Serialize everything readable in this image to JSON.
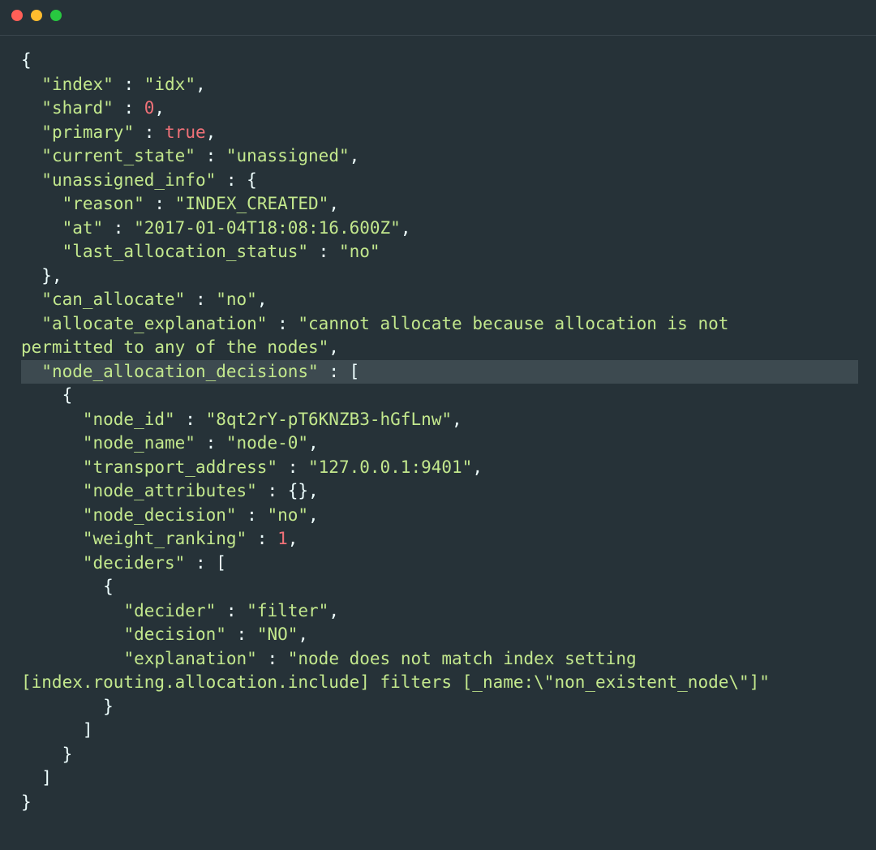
{
  "window": {
    "controls": [
      {
        "name": "close-button",
        "color": "#ff5f57"
      },
      {
        "name": "minimize-button",
        "color": "#febc2e"
      },
      {
        "name": "zoom-button",
        "color": "#28c840"
      }
    ]
  },
  "colors": {
    "background": "#263238",
    "string": "#c3e88d",
    "number": "#f07178",
    "punctuation": "#eeffff",
    "highlight": "#3d4a50"
  },
  "code": {
    "highlighted_line": 13,
    "lines": [
      [
        {
          "t": "p",
          "v": "{"
        }
      ],
      [
        {
          "t": "p",
          "v": "  "
        },
        {
          "t": "k",
          "v": "\"index\""
        },
        {
          "t": "p",
          "v": " : "
        },
        {
          "t": "s",
          "v": "\"idx\""
        },
        {
          "t": "p",
          "v": ","
        }
      ],
      [
        {
          "t": "p",
          "v": "  "
        },
        {
          "t": "k",
          "v": "\"shard\""
        },
        {
          "t": "p",
          "v": " : "
        },
        {
          "t": "n",
          "v": "0"
        },
        {
          "t": "p",
          "v": ","
        }
      ],
      [
        {
          "t": "p",
          "v": "  "
        },
        {
          "t": "k",
          "v": "\"primary\""
        },
        {
          "t": "p",
          "v": " : "
        },
        {
          "t": "b",
          "v": "true"
        },
        {
          "t": "p",
          "v": ","
        }
      ],
      [
        {
          "t": "p",
          "v": "  "
        },
        {
          "t": "k",
          "v": "\"current_state\""
        },
        {
          "t": "p",
          "v": " : "
        },
        {
          "t": "s",
          "v": "\"unassigned\""
        },
        {
          "t": "p",
          "v": ","
        }
      ],
      [
        {
          "t": "p",
          "v": "  "
        },
        {
          "t": "k",
          "v": "\"unassigned_info\""
        },
        {
          "t": "p",
          "v": " : {"
        }
      ],
      [
        {
          "t": "p",
          "v": "    "
        },
        {
          "t": "k",
          "v": "\"reason\""
        },
        {
          "t": "p",
          "v": " : "
        },
        {
          "t": "s",
          "v": "\"INDEX_CREATED\""
        },
        {
          "t": "p",
          "v": ","
        }
      ],
      [
        {
          "t": "p",
          "v": "    "
        },
        {
          "t": "k",
          "v": "\"at\""
        },
        {
          "t": "p",
          "v": " : "
        },
        {
          "t": "s",
          "v": "\"2017-01-04T18:08:16.600Z\""
        },
        {
          "t": "p",
          "v": ","
        }
      ],
      [
        {
          "t": "p",
          "v": "    "
        },
        {
          "t": "k",
          "v": "\"last_allocation_status\""
        },
        {
          "t": "p",
          "v": " : "
        },
        {
          "t": "s",
          "v": "\"no\""
        }
      ],
      [
        {
          "t": "p",
          "v": "  },"
        }
      ],
      [
        {
          "t": "p",
          "v": "  "
        },
        {
          "t": "k",
          "v": "\"can_allocate\""
        },
        {
          "t": "p",
          "v": " : "
        },
        {
          "t": "s",
          "v": "\"no\""
        },
        {
          "t": "p",
          "v": ","
        }
      ],
      [
        {
          "t": "p",
          "v": "  "
        },
        {
          "t": "k",
          "v": "\"allocate_explanation\""
        },
        {
          "t": "p",
          "v": " : "
        },
        {
          "t": "s",
          "v": "\"cannot allocate because allocation is not"
        }
      ],
      [
        {
          "t": "s",
          "v": "permitted to any of the nodes\""
        },
        {
          "t": "p",
          "v": ","
        }
      ],
      [
        {
          "t": "p",
          "v": "  "
        },
        {
          "t": "k",
          "v": "\"node_allocation_decisions\""
        },
        {
          "t": "p",
          "v": " : ["
        }
      ],
      [
        {
          "t": "p",
          "v": "    {"
        }
      ],
      [
        {
          "t": "p",
          "v": "      "
        },
        {
          "t": "k",
          "v": "\"node_id\""
        },
        {
          "t": "p",
          "v": " : "
        },
        {
          "t": "s",
          "v": "\"8qt2rY-pT6KNZB3-hGfLnw\""
        },
        {
          "t": "p",
          "v": ","
        }
      ],
      [
        {
          "t": "p",
          "v": "      "
        },
        {
          "t": "k",
          "v": "\"node_name\""
        },
        {
          "t": "p",
          "v": " : "
        },
        {
          "t": "s",
          "v": "\"node-0\""
        },
        {
          "t": "p",
          "v": ","
        }
      ],
      [
        {
          "t": "p",
          "v": "      "
        },
        {
          "t": "k",
          "v": "\"transport_address\""
        },
        {
          "t": "p",
          "v": " : "
        },
        {
          "t": "s",
          "v": "\"127.0.0.1:9401\""
        },
        {
          "t": "p",
          "v": ","
        }
      ],
      [
        {
          "t": "p",
          "v": "      "
        },
        {
          "t": "k",
          "v": "\"node_attributes\""
        },
        {
          "t": "p",
          "v": " : {},"
        }
      ],
      [
        {
          "t": "p",
          "v": "      "
        },
        {
          "t": "k",
          "v": "\"node_decision\""
        },
        {
          "t": "p",
          "v": " : "
        },
        {
          "t": "s",
          "v": "\"no\""
        },
        {
          "t": "p",
          "v": ","
        }
      ],
      [
        {
          "t": "p",
          "v": "      "
        },
        {
          "t": "k",
          "v": "\"weight_ranking\""
        },
        {
          "t": "p",
          "v": " : "
        },
        {
          "t": "n",
          "v": "1"
        },
        {
          "t": "p",
          "v": ","
        }
      ],
      [
        {
          "t": "p",
          "v": "      "
        },
        {
          "t": "k",
          "v": "\"deciders\""
        },
        {
          "t": "p",
          "v": " : ["
        }
      ],
      [
        {
          "t": "p",
          "v": "        {"
        }
      ],
      [
        {
          "t": "p",
          "v": "          "
        },
        {
          "t": "k",
          "v": "\"decider\""
        },
        {
          "t": "p",
          "v": " : "
        },
        {
          "t": "s",
          "v": "\"filter\""
        },
        {
          "t": "p",
          "v": ","
        }
      ],
      [
        {
          "t": "p",
          "v": "          "
        },
        {
          "t": "k",
          "v": "\"decision\""
        },
        {
          "t": "p",
          "v": " : "
        },
        {
          "t": "s",
          "v": "\"NO\""
        },
        {
          "t": "p",
          "v": ","
        }
      ],
      [
        {
          "t": "p",
          "v": "          "
        },
        {
          "t": "k",
          "v": "\"explanation\""
        },
        {
          "t": "p",
          "v": " : "
        },
        {
          "t": "s",
          "v": "\"node does not match index setting"
        }
      ],
      [
        {
          "t": "s",
          "v": "[index.routing.allocation.include] filters [_name:\\\"non_existent_node\\\"]\""
        }
      ],
      [
        {
          "t": "p",
          "v": "        }"
        }
      ],
      [
        {
          "t": "p",
          "v": "      ]"
        }
      ],
      [
        {
          "t": "p",
          "v": "    }"
        }
      ],
      [
        {
          "t": "p",
          "v": "  ]"
        }
      ],
      [
        {
          "t": "p",
          "v": "}"
        }
      ]
    ]
  }
}
